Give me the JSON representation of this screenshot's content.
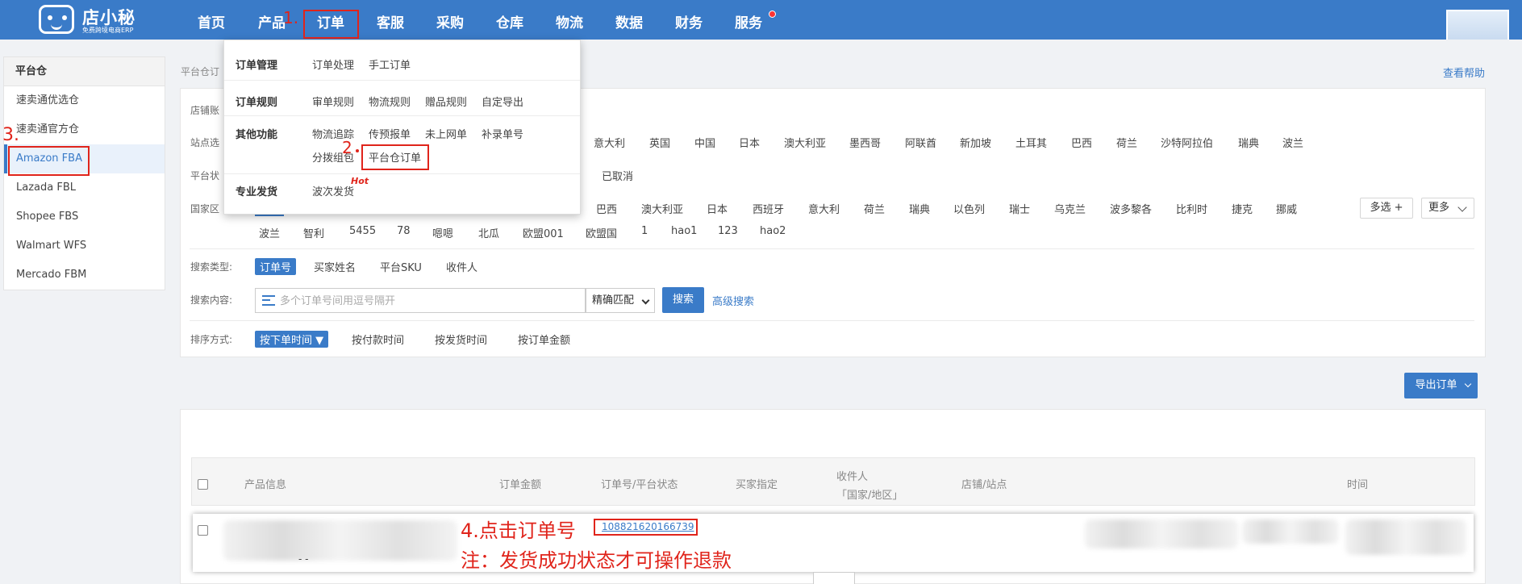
{
  "logo": {
    "name": "店小秘",
    "tagline": "免费跨境电商ERP"
  },
  "nav": {
    "items": [
      "首页",
      "产品",
      "订单",
      "客服",
      "采购",
      "仓库",
      "物流",
      "数据",
      "财务",
      "服务"
    ]
  },
  "sidebar": {
    "header": "平台仓",
    "items": [
      "速卖通优选仓",
      "速卖通官方仓",
      "Amazon FBA",
      "Lazada FBL",
      "Shopee FBS",
      "Walmart WFS",
      "Mercado FBM"
    ]
  },
  "breadcrumb": "平台仓订",
  "help_link": "查看帮助",
  "filters": {
    "shop_label": "店铺账",
    "site_label": "站点选",
    "site_options": [
      "意大利",
      "英国",
      "中国",
      "日本",
      "澳大利亚",
      "墨西哥",
      "阿联酋",
      "新加坡",
      "土耳其",
      "巴西",
      "荷兰",
      "沙特阿拉伯",
      "瑞典",
      "波兰"
    ],
    "status_label": "平台状",
    "status_options": [
      "已取消"
    ],
    "country_label": "国家区",
    "country_row1": [
      "巴西",
      "澳大利亚",
      "日本",
      "西班牙",
      "意大利",
      "荷兰",
      "瑞典",
      "以色列",
      "瑞士",
      "乌克兰",
      "波多黎各",
      "比利时",
      "捷克",
      "挪威"
    ],
    "country_row2": [
      "波兰",
      "智利",
      "5455",
      "78",
      "嗯嗯",
      "北瓜",
      "欧盟001",
      "欧盟国",
      "1",
      "hao1",
      "123",
      "hao2"
    ],
    "multi_select": "多选 +",
    "more": "更多",
    "search_type_label": "搜索类型:",
    "search_types": [
      "订单号",
      "买家姓名",
      "平台SKU",
      "收件人"
    ],
    "search_content_label": "搜索内容:",
    "search_placeholder": "多个订单号间用逗号隔开",
    "match_mode": "精确匹配",
    "search_button": "搜索",
    "advanced_search": "高级搜索",
    "sort_label": "排序方式:",
    "sort_options": [
      "按下单时间 ▼",
      "按付款时间",
      "按发货时间",
      "按订单金额"
    ]
  },
  "export_button": "导出订单",
  "table": {
    "headers": [
      "产品信息",
      "订单金额",
      "订单号/平台状态",
      "买家指定",
      "收件人",
      "「国家/地区」",
      "店铺/站点",
      "时间"
    ],
    "row": {
      "order_no": "108821620166739",
      "extra": "- -"
    }
  },
  "dropdown": {
    "sections": [
      {
        "title": "订单管理",
        "items": [
          "订单处理",
          "手工订单"
        ]
      },
      {
        "title": "订单规则",
        "items": [
          "审单规则",
          "物流规则",
          "赠品规则",
          "自定导出"
        ]
      },
      {
        "title": "其他功能",
        "items": [
          "物流追踪",
          "传预报单",
          "未上网单",
          "补录单号",
          "分拨组包",
          "平台仓订单"
        ]
      },
      {
        "title": "专业发货",
        "items": [
          "波次发货"
        ]
      }
    ],
    "hot_badge": "Hot"
  },
  "annotations": {
    "step1": "1.",
    "step2": "2",
    "step3": "3.",
    "step4": "4.点击订单号",
    "note": "注：发货成功状态才可操作退款"
  },
  "colors": {
    "primary": "#3a7bc8",
    "annotation": "#e0241b"
  }
}
